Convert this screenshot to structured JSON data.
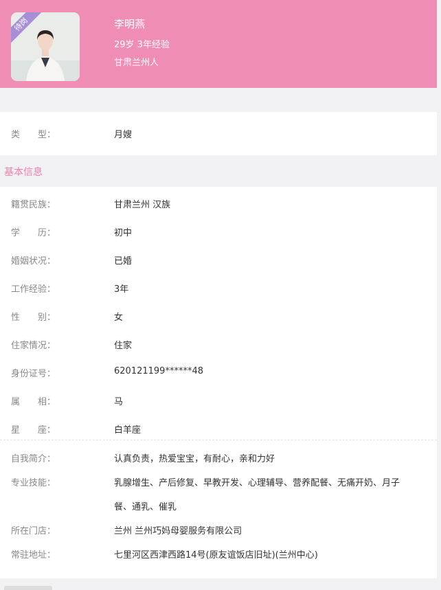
{
  "profile": {
    "badge": "待岗",
    "name": "李明燕",
    "age_exp": "29岁 3年经验",
    "hometown": "甘肃兰州人"
  },
  "type_row": {
    "label": "类　　型：",
    "value": "月嫂"
  },
  "basic_info_title": "基本信息",
  "info_rows": [
    {
      "label": "籍贯民族：",
      "value": "甘肃兰州 汉族"
    },
    {
      "label": "学　　历：",
      "value": "初中"
    },
    {
      "label": "婚姻状况：",
      "value": "已婚"
    },
    {
      "label": "工作经验：",
      "value": "3年"
    },
    {
      "label": "性　　别：",
      "value": "女"
    },
    {
      "label": "住家情况：",
      "value": "住家"
    },
    {
      "label": "身份证号：",
      "value": "620121199******48"
    },
    {
      "label": "属　　相：",
      "value": "马"
    },
    {
      "label": "星　　座：",
      "value": "白羊座"
    }
  ],
  "detail_rows": {
    "intro": {
      "label": "自我简介：",
      "value": "认真负责，热爱宝宝，有耐心，亲和力好"
    },
    "skills": {
      "label": "专业技能：",
      "value_line1": "乳腺增生、产后修复、早教开发、心理辅导、营养配餐、无痛开奶、月子",
      "value_line2": "餐、通乳、催乳"
    },
    "store": {
      "label": "所在门店：",
      "value": "兰州 兰州巧妈母婴服务有限公司"
    },
    "address": {
      "label": "常驻地址：",
      "value": "七里河区西津西路14号(原友谊饭店旧址)(兰州中心)"
    }
  },
  "colors": {
    "header_bg": "#f08db4",
    "accent": "#ee80ad",
    "badge_bg": "#a78fd8"
  }
}
